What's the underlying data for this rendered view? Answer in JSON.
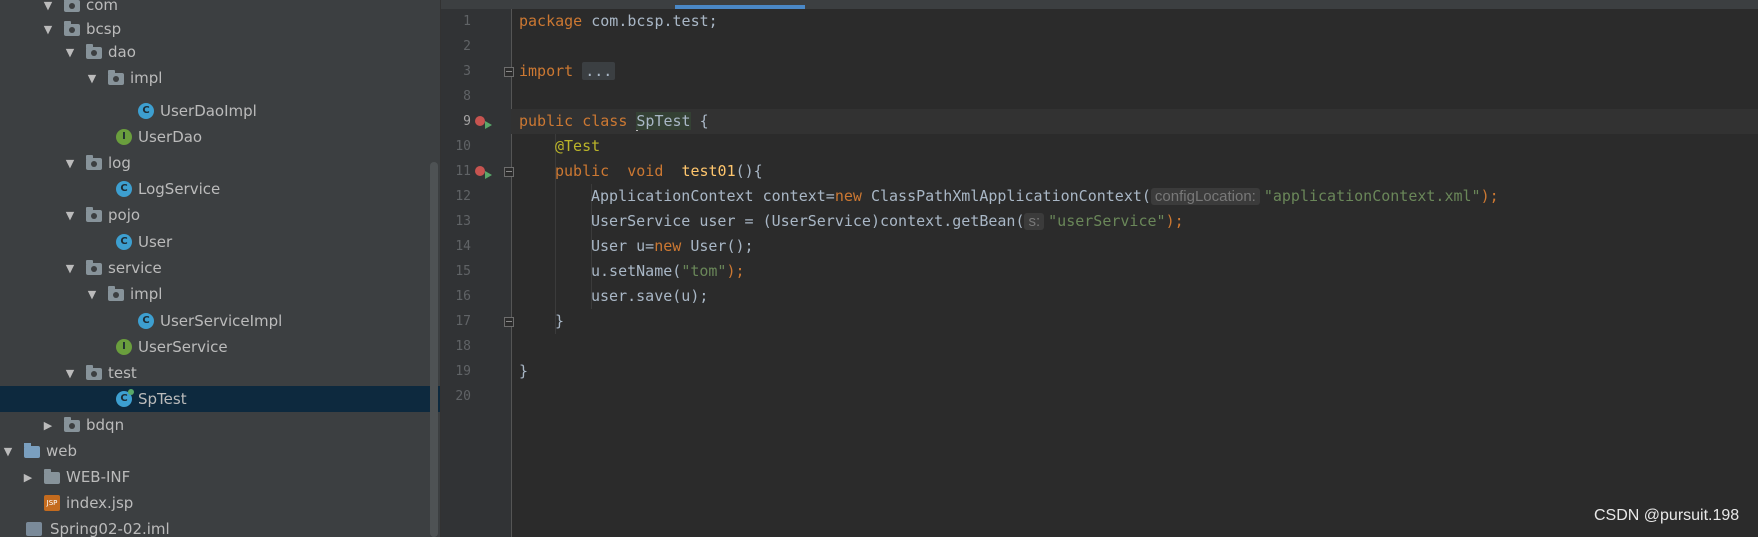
{
  "tree": {
    "items": [
      {
        "label": "com",
        "kind": "package",
        "expanded": true
      },
      {
        "label": "bcsp",
        "kind": "package",
        "expanded": true
      },
      {
        "label": "dao",
        "kind": "package",
        "expanded": true
      },
      {
        "label": "impl",
        "kind": "package",
        "expanded": true
      },
      {
        "label": "UserDaoImpl",
        "kind": "class",
        "icon_letter": "C"
      },
      {
        "label": "UserDao",
        "kind": "interface",
        "icon_letter": "I"
      },
      {
        "label": "log",
        "kind": "package",
        "expanded": true
      },
      {
        "label": "LogService",
        "kind": "class",
        "icon_letter": "C"
      },
      {
        "label": "pojo",
        "kind": "package",
        "expanded": true
      },
      {
        "label": "User",
        "kind": "class",
        "icon_letter": "C"
      },
      {
        "label": "service",
        "kind": "package",
        "expanded": true
      },
      {
        "label": "impl",
        "kind": "package",
        "expanded": true
      },
      {
        "label": "UserServiceImpl",
        "kind": "class",
        "icon_letter": "C"
      },
      {
        "label": "UserService",
        "kind": "interface",
        "icon_letter": "I"
      },
      {
        "label": "test",
        "kind": "package",
        "expanded": true
      },
      {
        "label": "SpTest",
        "kind": "test-class",
        "icon_letter": "C",
        "selected": true
      },
      {
        "label": "bdqn",
        "kind": "package",
        "expanded": false
      },
      {
        "label": "web",
        "kind": "web-folder",
        "expanded": true
      },
      {
        "label": "WEB-INF",
        "kind": "folder",
        "expanded": false
      },
      {
        "label": "index.jsp",
        "kind": "jsp",
        "icon_letter": "JSP"
      },
      {
        "label": "Spring02-02.iml",
        "kind": "iml"
      }
    ]
  },
  "editor": {
    "current_line": 9,
    "line_numbers": [
      "1",
      "2",
      "3",
      "8",
      "9",
      "10",
      "11",
      "12",
      "13",
      "14",
      "15",
      "16",
      "17",
      "18",
      "19",
      "20"
    ],
    "code": {
      "l1_kw": "package",
      "l1_rest": " com.bcsp.test;",
      "l3_kw": "import",
      "l3_fold": "...",
      "l9_kw": "public class ",
      "l9_name": "SpTest",
      "l9_rest": " {",
      "l10_ann": "@Test",
      "l11_kw": "public  void  ",
      "l11_fn": "test01",
      "l11_rest": "(){",
      "l12_a": "ApplicationContext context=",
      "l12_new": "new",
      "l12_b": " ClassPathXmlApplicationContext(",
      "l12_hint": "configLocation:",
      "l12_str": "\"applicationContext.xml\"",
      "l12_end": ");",
      "l13_a": "UserService user = (UserService)context.getBean(",
      "l13_hint": "s:",
      "l13_str": "\"userService\"",
      "l13_end": ");",
      "l14_a": "User u=",
      "l14_new": "new",
      "l14_b": " User();",
      "l15_a": "u.setName(",
      "l15_str": "\"tom\"",
      "l15_end": ");",
      "l16": "user.save(u);",
      "l17": "}",
      "l19": "}"
    }
  },
  "watermark": "CSDN @pursuit.198",
  "colors": {
    "keyword": "#cc7832",
    "string": "#6a8759",
    "annotation": "#bbb529",
    "method": "#ffc66d",
    "text": "#a9b7c6",
    "selection": "#0d293e"
  }
}
